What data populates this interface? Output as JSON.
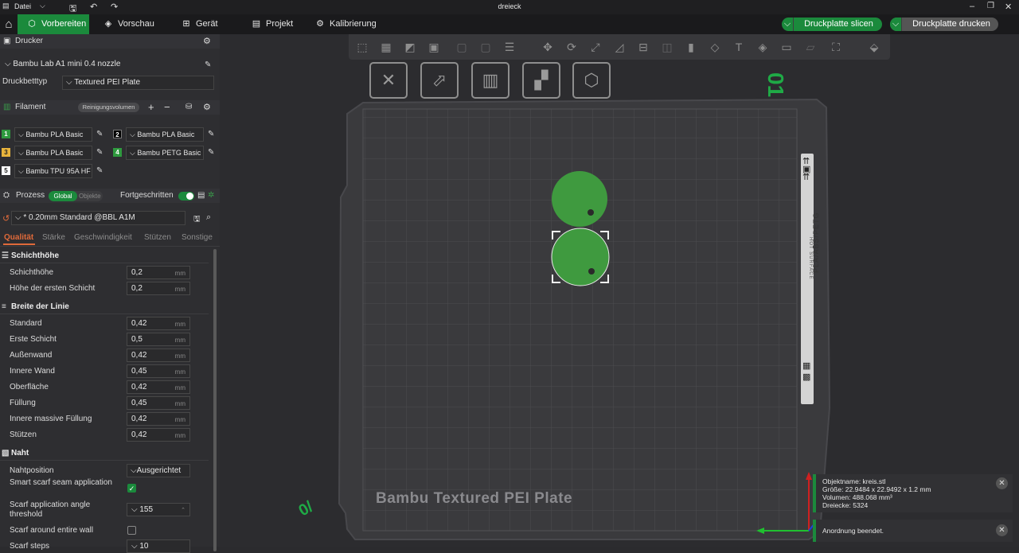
{
  "titlebar": {
    "file_menu": "Datei",
    "window_title": "dreieck"
  },
  "tabs": [
    {
      "label": "Vorbereiten",
      "icon": "cube-icon"
    },
    {
      "label": "Vorschau",
      "icon": "layers-icon"
    },
    {
      "label": "Gerät",
      "icon": "device-icon"
    },
    {
      "label": "Projekt",
      "icon": "project-icon"
    },
    {
      "label": "Kalibrierung",
      "icon": "calibration-icon"
    }
  ],
  "actions": {
    "slice": "Druckplatte slicen",
    "print": "Druckplatte drucken"
  },
  "printer": {
    "header": "Drucker",
    "name": "Bambu Lab A1 mini 0.4 nozzle",
    "bed_label": "Druckbetttyp",
    "bed_value": "Textured PEI Plate"
  },
  "filament": {
    "header": "Filament",
    "purge_button": "Reinigungsvolumen",
    "slots": [
      {
        "num": "1",
        "name": "Bambu PLA Basic",
        "color": "#2e9a3e"
      },
      {
        "num": "2",
        "name": "Bambu PLA Basic",
        "color": "#000000"
      },
      {
        "num": "3",
        "name": "Bambu PLA Basic",
        "color": "#e8b43c"
      },
      {
        "num": "4",
        "name": "Bambu PETG Basic",
        "color": "#2e9a3e"
      },
      {
        "num": "5",
        "name": "Bambu TPU 95A HF",
        "color": "#ffffff"
      }
    ]
  },
  "process": {
    "header": "Prozess",
    "toggle_global": "Global",
    "toggle_objects": "Objekte",
    "advanced_label": "Fortgeschritten",
    "preset": "* 0.20mm Standard @BBL A1M",
    "tabs": [
      "Qualität",
      "Stärke",
      "Geschwindigkeit",
      "Stützen",
      "Sonstige"
    ]
  },
  "quality": {
    "layer_group": "Schichthöhe",
    "layer_rows": [
      {
        "label": "Schichthöhe",
        "value": "0,2",
        "unit": "mm"
      },
      {
        "label": "Höhe der ersten Schicht",
        "value": "0,2",
        "unit": "mm"
      }
    ],
    "width_group": "Breite der Linie",
    "width_rows": [
      {
        "label": "Standard",
        "value": "0,42",
        "unit": "mm"
      },
      {
        "label": "Erste Schicht",
        "value": "0,5",
        "unit": "mm"
      },
      {
        "label": "Außenwand",
        "value": "0,42",
        "unit": "mm"
      },
      {
        "label": "Innere Wand",
        "value": "0,45",
        "unit": "mm"
      },
      {
        "label": "Oberfläche",
        "value": "0,42",
        "unit": "mm"
      },
      {
        "label": "Füllung",
        "value": "0,45",
        "unit": "mm"
      },
      {
        "label": "Innere massive Füllung",
        "value": "0,42",
        "unit": "mm"
      },
      {
        "label": "Stützen",
        "value": "0,42",
        "unit": "mm"
      }
    ],
    "seam_group": "Naht",
    "seam_position_label": "Nahtposition",
    "seam_position_value": "Ausgerichtet",
    "smart_scarf_label": "Smart scarf seam application",
    "smart_scarf_checked": true,
    "scarf_threshold_label": "Scarf application angle threshold",
    "scarf_threshold_value": "155",
    "scarf_around_label": "Scarf around entire wall",
    "scarf_around_checked": false,
    "scarf_steps_label": "Scarf steps",
    "scarf_steps_value": "10"
  },
  "plate": {
    "label": "Bambu Textured PEI Plate",
    "number": "01",
    "side_text": "PLA/ABS/PETG",
    "hot_text": "HOT SURFACE"
  },
  "object_info": {
    "name": "Objektname: kreis.stl",
    "size": "Größe: 22.9484 x 22.9492 x 1.2 mm",
    "volume": "Volumen: 488.068 mm³",
    "triangles": "Dreiecke: 5324"
  },
  "notice": "Anordnung beendet.",
  "colors": {
    "accent": "#1b8a3c",
    "object": "#3f9a3f"
  }
}
